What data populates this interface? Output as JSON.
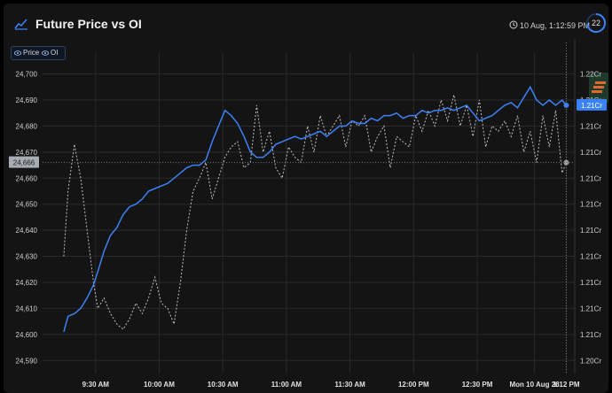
{
  "header": {
    "title": "Future Price vs OI",
    "timestamp": "10 Aug, 1:12:59 PM",
    "refresh_countdown": "22"
  },
  "legend": {
    "items": [
      {
        "label": "Price",
        "icon": "eye-icon"
      },
      {
        "label": "OI",
        "icon": "eye-icon"
      }
    ]
  },
  "colors": {
    "background": "#141414",
    "price_line": "#3b82f6",
    "oi_line": "#bfbfbf",
    "grid": "#2a2a2a",
    "accent_badge": "#e06a2c"
  },
  "chart_data": {
    "type": "line",
    "title": "Future Price vs OI",
    "x_tick_labels": [
      "9:30 AM",
      "10:00 AM",
      "10:30 AM",
      "11:00 AM",
      "11:30 AM",
      "12:00 PM",
      "12:30 PM",
      "Mon 10 Aug 26",
      "1:12 PM"
    ],
    "y_left_tick_labels": [
      "24,700",
      "24,690",
      "24,680",
      "24,670",
      "24,660",
      "24,650",
      "24,640",
      "24,630",
      "24,620",
      "24,610",
      "24,600",
      "24,590"
    ],
    "y_right_tick_labels": [
      "1.22Cr",
      "1.21Cr",
      "1.21Cr",
      "1.21Cr",
      "1.21Cr",
      "1.21Cr",
      "1.21Cr",
      "1.21Cr",
      "1.21Cr",
      "1.21Cr",
      "1.21Cr",
      "1.20Cr"
    ],
    "ylim_left": [
      24585,
      24710
    ],
    "crosshair_left_label": "24,666",
    "current_right_label": "1.21Cr",
    "grid": true,
    "series": [
      {
        "name": "Price",
        "axis": "left",
        "x": [
          "9:15",
          "9:17",
          "9:20",
          "9:23",
          "9:26",
          "9:29",
          "9:31",
          "9:34",
          "9:37",
          "9:40",
          "9:43",
          "9:46",
          "9:49",
          "9:52",
          "9:55",
          "9:58",
          "10:01",
          "10:04",
          "10:07",
          "10:10",
          "10:13",
          "10:16",
          "10:19",
          "10:22",
          "10:25",
          "10:28",
          "10:31",
          "10:34",
          "10:37",
          "10:40",
          "10:43",
          "10:46",
          "10:49",
          "10:52",
          "10:55",
          "10:58",
          "11:01",
          "11:04",
          "11:07",
          "11:10",
          "11:13",
          "11:16",
          "11:19",
          "11:22",
          "11:25",
          "11:28",
          "11:31",
          "11:34",
          "11:37",
          "11:40",
          "11:43",
          "11:46",
          "11:49",
          "11:52",
          "11:55",
          "11:58",
          "12:01",
          "12:04",
          "12:07",
          "12:10",
          "12:13",
          "12:16",
          "12:19",
          "12:22",
          "12:25",
          "12:28",
          "12:31",
          "12:34",
          "12:37",
          "12:40",
          "12:43",
          "12:46",
          "12:49",
          "12:52",
          "12:55",
          "12:58",
          "13:01",
          "13:04",
          "13:07",
          "13:10",
          "13:12"
        ],
        "values": [
          24601,
          24607,
          24608,
          24610,
          24614,
          24619,
          24624,
          24632,
          24638,
          24641,
          24646,
          24649,
          24650,
          24652,
          24655,
          24656,
          24657,
          24658,
          24660,
          24662,
          24664,
          24665,
          24665,
          24667,
          24674,
          24680,
          24686,
          24684,
          24681,
          24676,
          24670,
          24668,
          24668,
          24670,
          24673,
          24674,
          24675,
          24676,
          24675,
          24676,
          24677,
          24678,
          24676,
          24678,
          24680,
          24680,
          24682,
          24681,
          24681,
          24683,
          24682,
          24684,
          24684,
          24685,
          24683,
          24684,
          24684,
          24686,
          24685,
          24686,
          24686,
          24687,
          24686,
          24687,
          24688,
          24685,
          24682,
          24683,
          24684,
          24686,
          24688,
          24689,
          24687,
          24691,
          24695,
          24690,
          24688,
          24690,
          24688,
          24690,
          24688
        ]
      },
      {
        "name": "OI",
        "axis": "right",
        "x": [
          "9:15",
          "9:17",
          "9:20",
          "9:23",
          "9:26",
          "9:29",
          "9:31",
          "9:34",
          "9:37",
          "9:40",
          "9:43",
          "9:46",
          "9:49",
          "9:52",
          "9:55",
          "9:58",
          "10:01",
          "10:04",
          "10:07",
          "10:10",
          "10:13",
          "10:16",
          "10:19",
          "10:22",
          "10:25",
          "10:28",
          "10:31",
          "10:34",
          "10:37",
          "10:40",
          "10:43",
          "10:46",
          "10:49",
          "10:52",
          "10:55",
          "10:58",
          "11:01",
          "11:04",
          "11:07",
          "11:10",
          "11:13",
          "11:16",
          "11:19",
          "11:22",
          "11:25",
          "11:28",
          "11:31",
          "11:34",
          "11:37",
          "11:40",
          "11:43",
          "11:46",
          "11:49",
          "11:52",
          "11:55",
          "11:58",
          "12:01",
          "12:04",
          "12:07",
          "12:10",
          "12:13",
          "12:16",
          "12:19",
          "12:22",
          "12:25",
          "12:28",
          "12:31",
          "12:34",
          "12:37",
          "12:40",
          "12:43",
          "12:46",
          "12:49",
          "12:52",
          "12:55",
          "12:58",
          "13:01",
          "13:04",
          "13:07",
          "13:10",
          "13:12"
        ],
        "values": [
          24630,
          24655,
          24673,
          24660,
          24640,
          24620,
          24610,
          24614,
          24608,
          24604,
          24602,
          24606,
          24612,
          24608,
          24614,
          24622,
          24612,
          24610,
          24604,
          24620,
          24640,
          24655,
          24660,
          24666,
          24652,
          24660,
          24668,
          24672,
          24674,
          24664,
          24666,
          24688,
          24670,
          24678,
          24664,
          24660,
          24672,
          24668,
          24666,
          24680,
          24670,
          24684,
          24676,
          24680,
          24684,
          24672,
          24682,
          24680,
          24684,
          24670,
          24676,
          24680,
          24664,
          24676,
          24674,
          24672,
          24684,
          24678,
          24686,
          24680,
          24690,
          24682,
          24692,
          24680,
          24688,
          24676,
          24690,
          24672,
          24680,
          24678,
          24682,
          24676,
          24684,
          24670,
          24678,
          24666,
          24684,
          24672,
          24686,
          24662,
          24666
        ]
      }
    ]
  }
}
